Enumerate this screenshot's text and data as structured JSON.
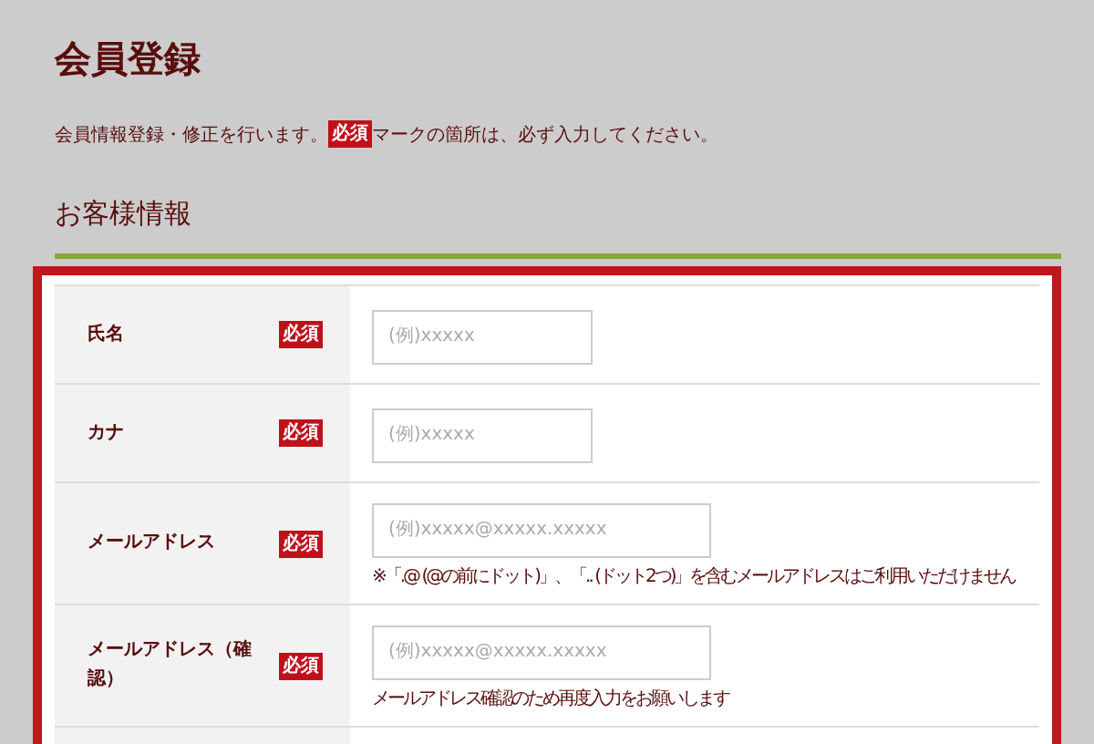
{
  "page_title": "会員登録",
  "intro": {
    "before": "会員情報登録・修正を行います。",
    "badge": "必須",
    "after": "マークの箇所は、必ず入力してください。"
  },
  "section_title": "お客様情報",
  "fields": [
    {
      "label": "氏名",
      "required": true,
      "badge": "必須",
      "kind": "short",
      "placeholder": "(例)xxxxx"
    },
    {
      "label": "カナ",
      "required": true,
      "badge": "必須",
      "kind": "short",
      "placeholder": "(例)xxxxx"
    },
    {
      "label": "メールアドレス",
      "required": true,
      "badge": "必須",
      "kind": "long",
      "placeholder": "(例)xxxxx@xxxxx.xxxxx",
      "note": "※「.@ (@の前にドット)」、「.. (ドット2つ)」を含むメールアドレスはご利用いただけません"
    },
    {
      "label": "メールアドレス（確認）",
      "required": true,
      "badge": "必須",
      "kind": "long",
      "placeholder": "(例)xxxxx@xxxxx.xxxxx",
      "note": "メールアドレス確認のため再度入力をお願いします"
    }
  ]
}
